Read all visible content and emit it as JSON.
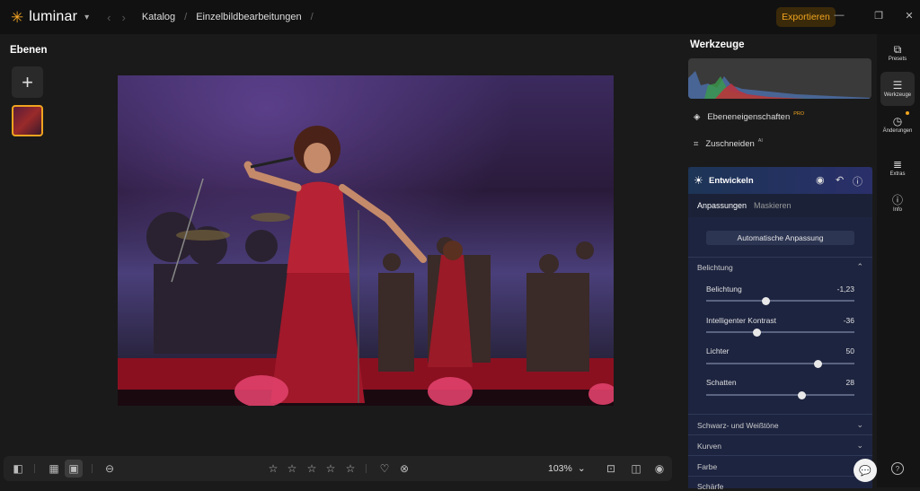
{
  "app": {
    "logo_text": "luminar",
    "logo_icon": "sun-star-icon"
  },
  "breadcrumb": [
    "Katalog",
    "Einzelbildbearbeitungen"
  ],
  "export_label": "Exportieren",
  "colors": {
    "accent": "#f0a41f",
    "panel": "#1d2440",
    "background": "#1a1a1a"
  },
  "layers": {
    "title": "Ebenen"
  },
  "bottom_bar": {
    "zoom": "103%",
    "stars": 5
  },
  "tools": {
    "title": "Werkzeuge",
    "layer_properties": "Ebeneneigenschaften",
    "layer_properties_badge": "PRO",
    "crop": "Zuschneiden",
    "crop_badge": "AI"
  },
  "develop": {
    "title": "Entwickeln",
    "tabs": [
      "Anpassungen",
      "Maskieren"
    ],
    "auto_button": "Automatische Anpassung",
    "exposure_section": "Belichtung",
    "sliders": [
      {
        "label": "Belichtung",
        "value": "-1,23",
        "position": 0.4
      },
      {
        "label": "Intelligenter Kontrast",
        "value": "-36",
        "position": 0.34
      },
      {
        "label": "Lichter",
        "value": "50",
        "position": 0.75
      },
      {
        "label": "Schatten",
        "value": "28",
        "position": 0.64
      }
    ],
    "collapsed_sections": [
      "Schwarz- und Weißtöne",
      "Kurven",
      "Farbe",
      "Schärfe"
    ]
  },
  "rail": [
    {
      "label": "Presets",
      "icon": "presets-icon"
    },
    {
      "label": "Werkzeuge",
      "icon": "sliders-icon"
    },
    {
      "label": "Änderungen",
      "icon": "history-icon"
    },
    {
      "label": "Extras",
      "icon": "list-icon"
    },
    {
      "label": "Info",
      "icon": "info-icon"
    }
  ]
}
